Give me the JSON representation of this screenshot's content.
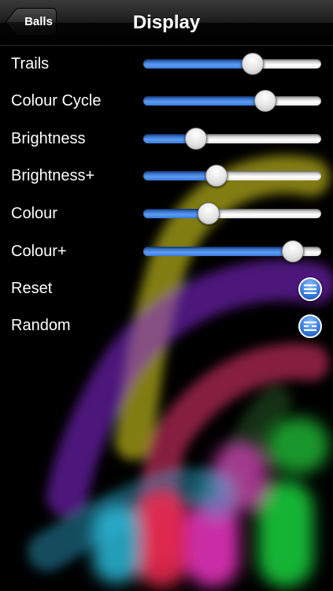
{
  "nav": {
    "back_label": "Balls",
    "title": "Display"
  },
  "settings": [
    {
      "label": "Trails",
      "type": "slider",
      "value": 0.63
    },
    {
      "label": "Colour Cycle",
      "type": "slider",
      "value": 0.71
    },
    {
      "label": "Brightness",
      "type": "slider",
      "value": 0.27
    },
    {
      "label": "Brightness+",
      "type": "slider",
      "value": 0.4
    },
    {
      "label": "Colour",
      "type": "slider",
      "value": 0.35
    },
    {
      "label": "Colour+",
      "type": "slider",
      "value": 0.89
    },
    {
      "label": "Reset",
      "type": "button",
      "icon": "list-icon"
    },
    {
      "label": "Random",
      "type": "button",
      "icon": "list-icon"
    }
  ],
  "colors": {
    "slider_fill": "#3c7ce2",
    "button_blue": "#3a7ee0"
  }
}
